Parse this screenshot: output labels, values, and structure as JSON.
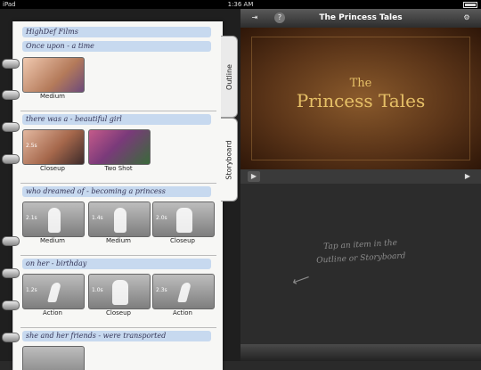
{
  "status_bar": {
    "device": "iPad",
    "time": "1:36 AM"
  },
  "outline_panel": {
    "tabs": {
      "outline": "Outline",
      "storyboard": "Storyboard"
    },
    "sections": [
      {
        "heading": "HighDef Films",
        "clips": []
      },
      {
        "heading": "Once upon - a time",
        "clips": [
          {
            "label": "Medium",
            "duration": ""
          }
        ]
      },
      {
        "heading": "there was a - beautiful girl",
        "clips": [
          {
            "label": "Closeup",
            "duration": "2.5s"
          },
          {
            "label": "Two Shot",
            "duration": ""
          }
        ]
      },
      {
        "heading": "who dreamed of - becoming a princess",
        "clips": [
          {
            "label": "Medium",
            "duration": "2.1s"
          },
          {
            "label": "Medium",
            "duration": "1.4s"
          },
          {
            "label": "Closeup",
            "duration": "2.0s"
          }
        ]
      },
      {
        "heading": "on her - birthday",
        "clips": [
          {
            "label": "Action",
            "duration": "1.2s"
          },
          {
            "label": "Closeup",
            "duration": "1.0s"
          },
          {
            "label": "Action",
            "duration": "2.3s"
          }
        ]
      },
      {
        "heading": "she and her friends - were transported",
        "clips": []
      }
    ]
  },
  "preview": {
    "title": "The Princess Tales",
    "title_line1": "The",
    "title_line2": "Princess Tales"
  },
  "empty_state": {
    "line1": "Tap an item in the",
    "line2": "Outline or Storyboard"
  },
  "icons": {
    "export": "export-icon",
    "help": "help-icon",
    "settings": "gear-icon",
    "play_left": "play-icon",
    "play_right": "play-icon"
  }
}
